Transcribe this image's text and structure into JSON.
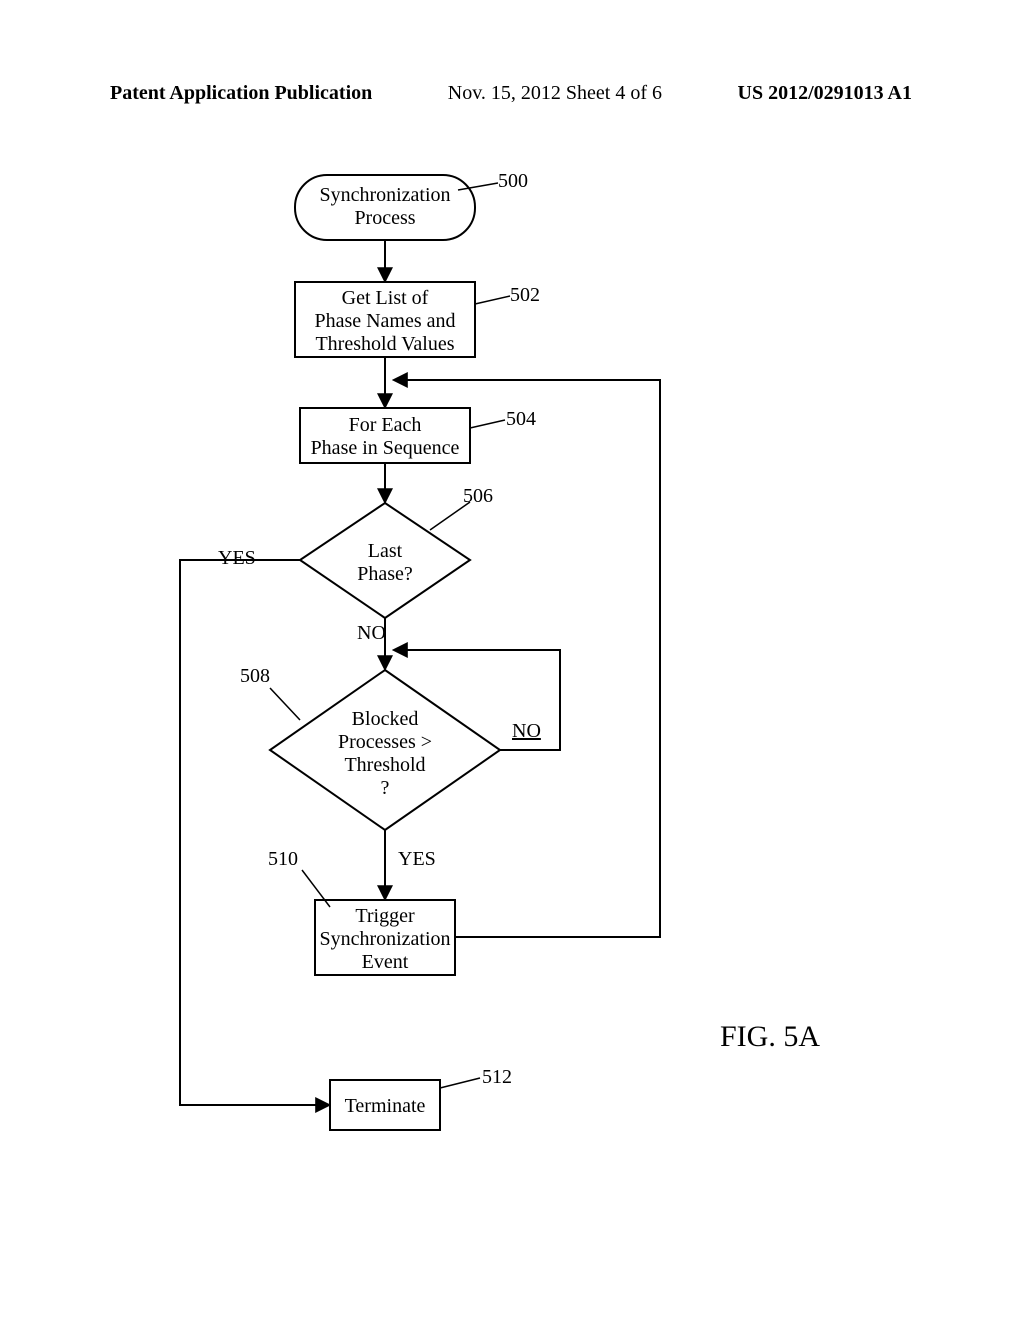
{
  "header": {
    "left": "Patent Application Publication",
    "mid": "Nov. 15, 2012  Sheet 4 of 6",
    "right": "US 2012/0291013 A1"
  },
  "figure_label": "FIG. 5A",
  "nodes": {
    "n500": {
      "ref": "500",
      "text": "Synchronization\nProcess"
    },
    "n502": {
      "ref": "502",
      "text": "Get List of\nPhase Names and\nThreshold Values"
    },
    "n504": {
      "ref": "504",
      "text": "For Each\nPhase in Sequence"
    },
    "n506": {
      "ref": "506",
      "text": "Last\nPhase?"
    },
    "n508": {
      "ref": "508",
      "text": "Blocked\nProcesses >\nThreshold\n?"
    },
    "n510": {
      "ref": "510",
      "text": "Trigger\nSynchronization\nEvent"
    },
    "n512": {
      "ref": "512",
      "text": "Terminate"
    }
  },
  "edge_labels": {
    "yes506": "YES",
    "no506": "NO",
    "no508": "NO",
    "yes508": "YES"
  },
  "chart_data": {
    "type": "flowchart",
    "nodes": [
      {
        "id": "500",
        "kind": "terminator",
        "label": "Synchronization Process"
      },
      {
        "id": "502",
        "kind": "process",
        "label": "Get List of Phase Names and Threshold Values"
      },
      {
        "id": "504",
        "kind": "process",
        "label": "For Each Phase in Sequence"
      },
      {
        "id": "506",
        "kind": "decision",
        "label": "Last Phase?"
      },
      {
        "id": "508",
        "kind": "decision",
        "label": "Blocked Processes > Threshold ?"
      },
      {
        "id": "510",
        "kind": "process",
        "label": "Trigger Synchronization Event"
      },
      {
        "id": "512",
        "kind": "process",
        "label": "Terminate"
      }
    ],
    "edges": [
      {
        "from": "500",
        "to": "502",
        "label": ""
      },
      {
        "from": "502",
        "to": "504",
        "label": ""
      },
      {
        "from": "504",
        "to": "506",
        "label": ""
      },
      {
        "from": "506",
        "to": "512",
        "label": "YES"
      },
      {
        "from": "506",
        "to": "508",
        "label": "NO"
      },
      {
        "from": "508",
        "to": "508",
        "label": "NO",
        "note": "loop back to self (re-check)"
      },
      {
        "from": "508",
        "to": "510",
        "label": "YES"
      },
      {
        "from": "510",
        "to": "504",
        "label": "",
        "note": "loop to next phase"
      }
    ]
  }
}
